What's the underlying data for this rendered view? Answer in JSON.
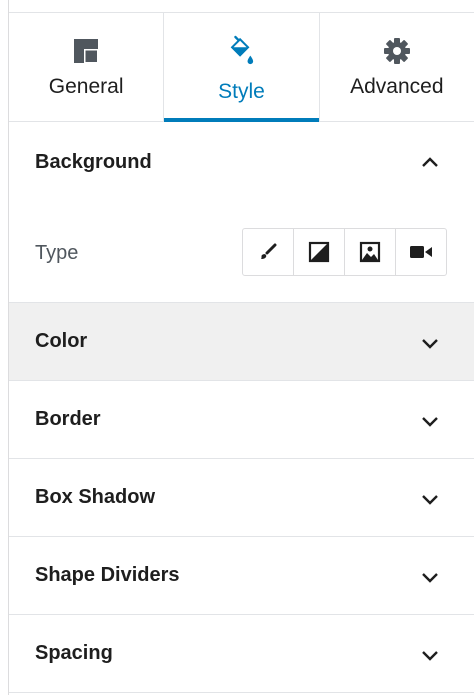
{
  "tabs": [
    {
      "label": "General",
      "icon": "layout-icon",
      "active": false
    },
    {
      "label": "Style",
      "icon": "paint-bucket-icon",
      "active": true
    },
    {
      "label": "Advanced",
      "icon": "gear-icon",
      "active": false
    }
  ],
  "background": {
    "title": "Background",
    "type_label": "Type",
    "type_options": [
      "brush-icon",
      "gradient-icon",
      "image-icon",
      "video-camera-icon"
    ]
  },
  "sections": [
    {
      "title": "Color"
    },
    {
      "title": "Border"
    },
    {
      "title": "Box Shadow"
    },
    {
      "title": "Shape Dividers"
    },
    {
      "title": "Spacing"
    }
  ],
  "colors": {
    "accent": "#007cba",
    "text": "#1e1e1e",
    "muted": "#50575e",
    "border": "#e2e4e7",
    "hover_row": "#f0f0f0"
  }
}
